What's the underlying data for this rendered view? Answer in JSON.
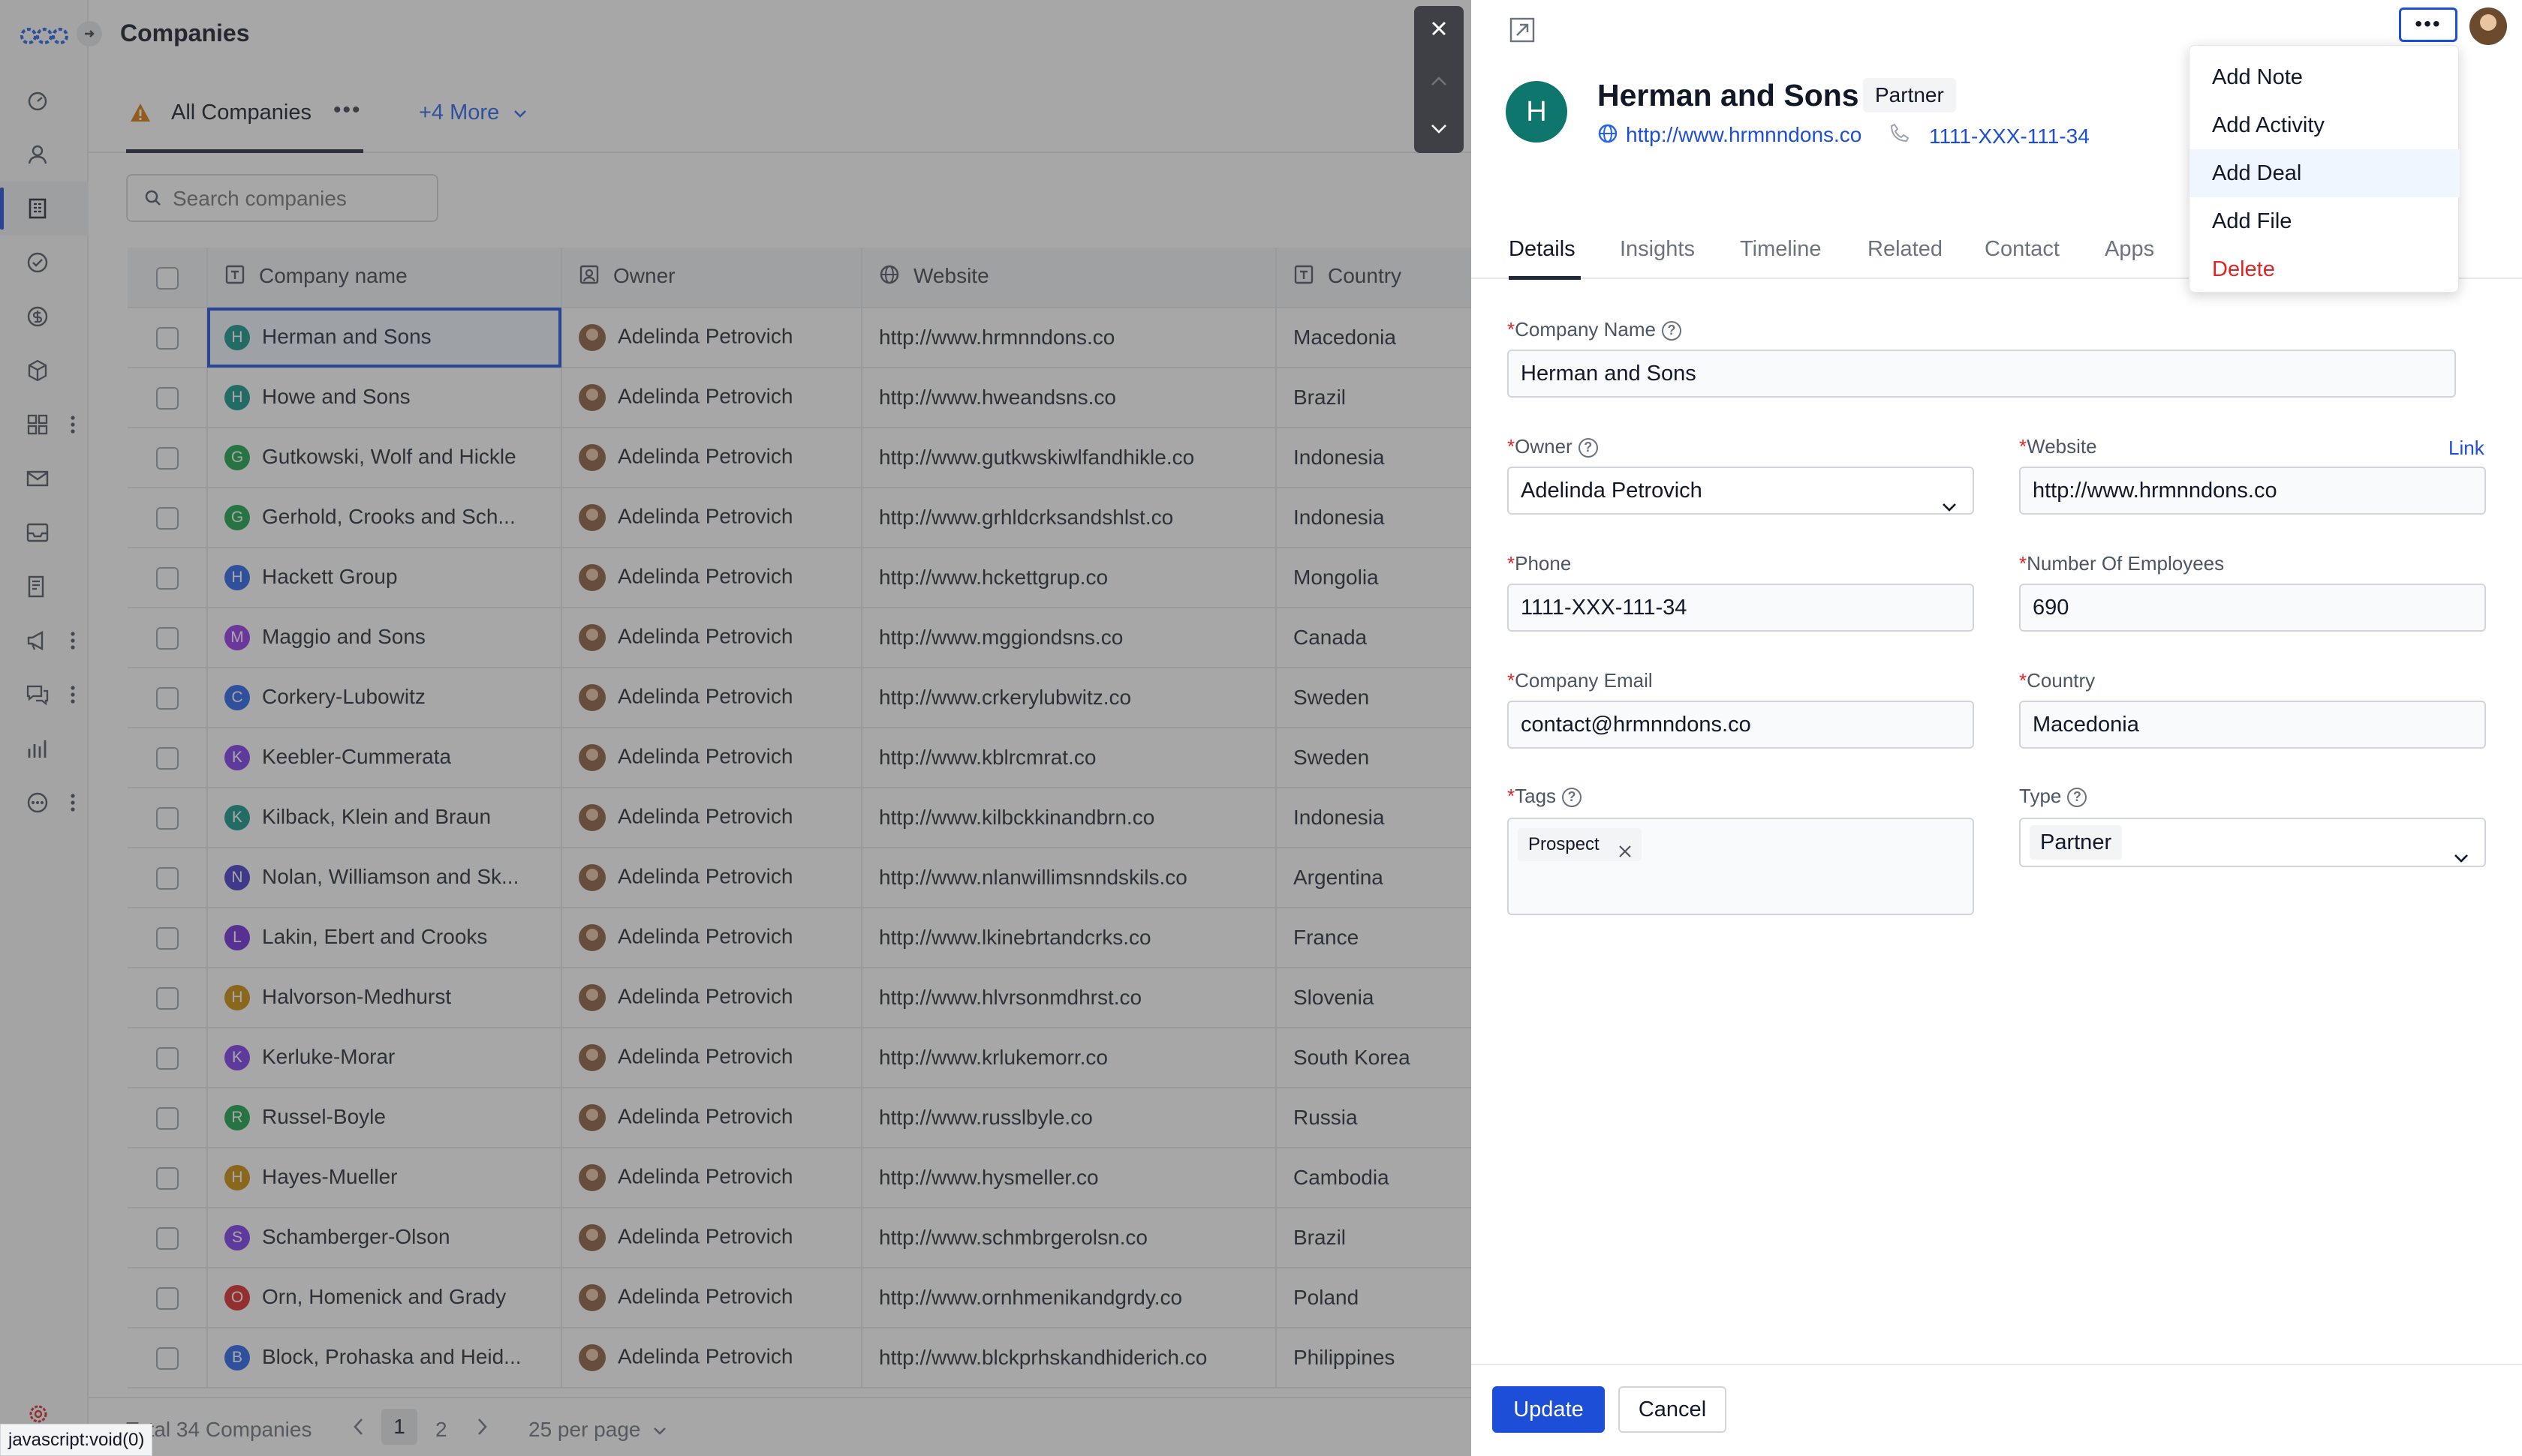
{
  "app": {
    "title": "Companies"
  },
  "sidebar": {
    "items": [
      "dashboard",
      "contacts",
      "companies",
      "tasks",
      "deals",
      "products",
      "apps",
      "mail",
      "inbox",
      "forms",
      "campaigns",
      "chat",
      "reports",
      "more"
    ]
  },
  "views": {
    "active_label": "All Companies",
    "more_label": "+4 More"
  },
  "search": {
    "placeholder": "Search companies"
  },
  "table": {
    "columns": [
      "Company name",
      "Owner",
      "Website",
      "Country"
    ],
    "rows": [
      {
        "letter": "H",
        "color": "#0d9488",
        "name": "Herman and Sons",
        "owner": "Adelinda Petrovich",
        "website": "http://www.hrmnndons.co",
        "country": "Macedonia"
      },
      {
        "letter": "H",
        "color": "#0d9488",
        "name": "Howe and Sons",
        "owner": "Adelinda Petrovich",
        "website": "http://www.hweandsns.co",
        "country": "Brazil"
      },
      {
        "letter": "G",
        "color": "#16a34a",
        "name": "Gutkowski, Wolf and Hickle",
        "owner": "Adelinda Petrovich",
        "website": "http://www.gutkwskiwlfandhikle.co",
        "country": "Indonesia"
      },
      {
        "letter": "G",
        "color": "#16a34a",
        "name": "Gerhold, Crooks and Sch...",
        "owner": "Adelinda Petrovich",
        "website": "http://www.grhldcrksandshlst.co",
        "country": "Indonesia"
      },
      {
        "letter": "H",
        "color": "#2563eb",
        "name": "Hackett Group",
        "owner": "Adelinda Petrovich",
        "website": "http://www.hckettgrup.co",
        "country": "Mongolia"
      },
      {
        "letter": "M",
        "color": "#9333ea",
        "name": "Maggio and Sons",
        "owner": "Adelinda Petrovich",
        "website": "http://www.mggiondsns.co",
        "country": "Canada"
      },
      {
        "letter": "C",
        "color": "#2563eb",
        "name": "Corkery-Lubowitz",
        "owner": "Adelinda Petrovich",
        "website": "http://www.crkerylubwitz.co",
        "country": "Sweden"
      },
      {
        "letter": "K",
        "color": "#7c3aed",
        "name": "Keebler-Cummerata",
        "owner": "Adelinda Petrovich",
        "website": "http://www.kblrcmrat.co",
        "country": "Sweden"
      },
      {
        "letter": "K",
        "color": "#0d9488",
        "name": "Kilback, Klein and Braun",
        "owner": "Adelinda Petrovich",
        "website": "http://www.kilbckkinandbrn.co",
        "country": "Indonesia"
      },
      {
        "letter": "N",
        "color": "#4338ca",
        "name": "Nolan, Williamson and Sk...",
        "owner": "Adelinda Petrovich",
        "website": "http://www.nlanwillimsnndskils.co",
        "country": "Argentina"
      },
      {
        "letter": "L",
        "color": "#6d28d9",
        "name": "Lakin, Ebert and Crooks",
        "owner": "Adelinda Petrovich",
        "website": "http://www.lkinebrtandcrks.co",
        "country": "France"
      },
      {
        "letter": "H",
        "color": "#ca8a04",
        "name": "Halvorson-Medhurst",
        "owner": "Adelinda Petrovich",
        "website": "http://www.hlvrsonmdhrst.co",
        "country": "Slovenia"
      },
      {
        "letter": "K",
        "color": "#7c3aed",
        "name": "Kerluke-Morar",
        "owner": "Adelinda Petrovich",
        "website": "http://www.krlukemorr.co",
        "country": "South Korea"
      },
      {
        "letter": "R",
        "color": "#16a34a",
        "name": "Russel-Boyle",
        "owner": "Adelinda Petrovich",
        "website": "http://www.russlbyle.co",
        "country": "Russia"
      },
      {
        "letter": "H",
        "color": "#ca8a04",
        "name": "Hayes-Mueller",
        "owner": "Adelinda Petrovich",
        "website": "http://www.hysmeller.co",
        "country": "Cambodia"
      },
      {
        "letter": "S",
        "color": "#7c3aed",
        "name": "Schamberger-Olson",
        "owner": "Adelinda Petrovich",
        "website": "http://www.schmbrgerolsn.co",
        "country": "Brazil"
      },
      {
        "letter": "O",
        "color": "#dc2626",
        "name": "Orn, Homenick and Grady",
        "owner": "Adelinda Petrovich",
        "website": "http://www.ornhmenikandgrdy.co",
        "country": "Poland"
      },
      {
        "letter": "B",
        "color": "#2563eb",
        "name": "Block, Prohaska and Heid...",
        "owner": "Adelinda Petrovich",
        "website": "http://www.blckprhskandhiderich.co",
        "country": "Philippines"
      }
    ]
  },
  "pager": {
    "total": "Total 34 Companies",
    "page1": "1",
    "page2": "2",
    "per_page": "25 per page"
  },
  "status_bar": "javascript:void(0)",
  "record": {
    "initial": "H",
    "name": "Herman and Sons",
    "type_badge": "Partner",
    "website": "http://www.hrmnndons.co",
    "phone": "1111-XXX-111-34"
  },
  "panel_tabs": [
    "Details",
    "Insights",
    "Timeline",
    "Related",
    "Contact",
    "Apps"
  ],
  "form": {
    "company_name_label": "Company Name",
    "company_name": "Herman and Sons",
    "owner_label": "Owner",
    "owner": "Adelinda Petrovich",
    "website_label": "Website",
    "website_link": "Link",
    "website": "http://www.hrmnndons.co",
    "phone_label": "Phone",
    "phone": "1111-XXX-111-34",
    "employees_label": "Number Of Employees",
    "employees": "690",
    "email_label": "Company Email",
    "email": "contact@hrmnndons.co",
    "country_label": "Country",
    "country": "Macedonia",
    "tags_label": "Tags",
    "tag": "Prospect",
    "type_label": "Type",
    "type": "Partner"
  },
  "actions": {
    "update": "Update",
    "cancel": "Cancel"
  },
  "menu": {
    "items": [
      "Add Note",
      "Add Activity",
      "Add Deal",
      "Add File",
      "Delete"
    ]
  },
  "colors": {
    "accent": "#1d4ed8",
    "danger": "#dc2626",
    "avatar_teal": "#0f766e"
  }
}
